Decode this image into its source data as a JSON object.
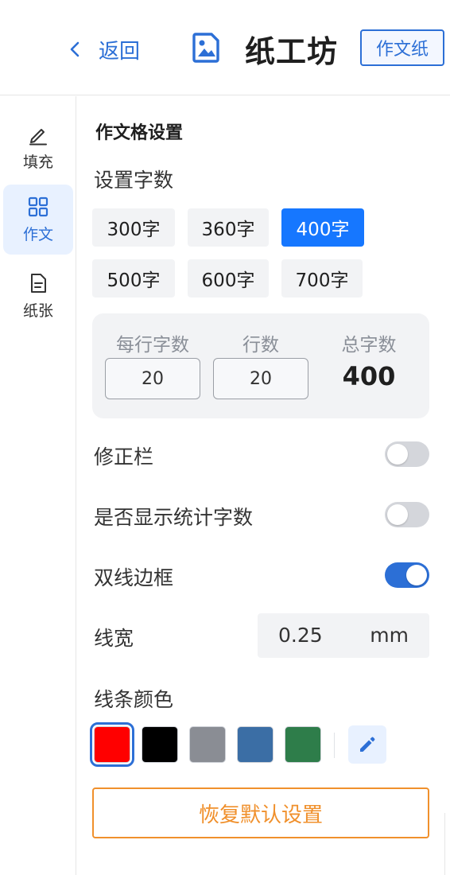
{
  "header": {
    "back_label": "返回",
    "title": "纸工坊",
    "mode_badge": "作文纸"
  },
  "sidebar": {
    "items": [
      {
        "label": "填充",
        "icon": "pencil-icon",
        "active": false
      },
      {
        "label": "作文",
        "icon": "grid-icon",
        "active": true
      },
      {
        "label": "纸张",
        "icon": "document-icon",
        "active": false
      }
    ]
  },
  "panel": {
    "section_title": "作文格设置",
    "word_count_label": "设置字数",
    "word_count_options": [
      "300字",
      "360字",
      "400字",
      "500字",
      "600字",
      "700字"
    ],
    "word_count_selected": "400字",
    "grid": {
      "per_row_label": "每行字数",
      "per_row_value": "20",
      "rows_label": "行数",
      "rows_value": "20",
      "total_label": "总字数",
      "total_value": "400"
    },
    "toggles": [
      {
        "label": "修正栏",
        "on": false
      },
      {
        "label": "是否显示统计字数",
        "on": false
      },
      {
        "label": "双线边框",
        "on": true
      }
    ],
    "line_width": {
      "label": "线宽",
      "value": "0.25",
      "unit": "mm"
    },
    "line_color": {
      "label": "线条颜色",
      "swatches": [
        "#ff0000",
        "#000000",
        "#8a8d94",
        "#3b6ea5",
        "#2e7d4a"
      ],
      "selected": "#ff0000"
    },
    "reset_label": "恢复默认设置"
  },
  "colors": {
    "accent": "#2c6fd6",
    "primary_button": "#1677ff",
    "reset": "#f0902c"
  }
}
